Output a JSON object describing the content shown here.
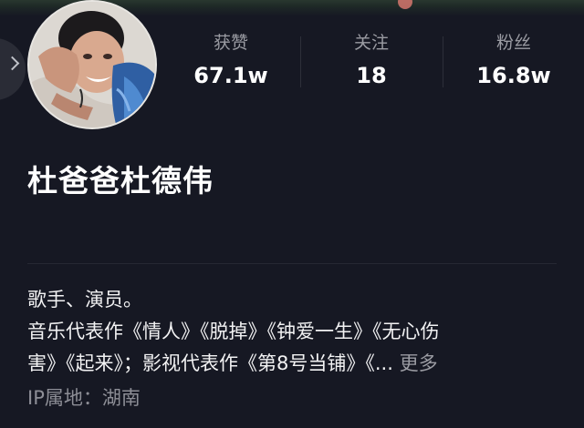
{
  "profile": {
    "name": "杜爸爸杜德伟",
    "stats": [
      {
        "label": "获赞",
        "value": "67.1w"
      },
      {
        "label": "关注",
        "value": "18"
      },
      {
        "label": "粉丝",
        "value": "16.8w"
      }
    ],
    "bio_line1": "歌手、演员。",
    "bio_line2": "音乐代表作《情人》《脱掉》《钟爱一生》《无心伤",
    "bio_line3": "害》《起来》；影视代表作《第8号当铺》《...",
    "more_label": "更多",
    "ip_location": "IP属地：湖南"
  },
  "icons": {
    "side_toggle": "chevron-right-icon"
  }
}
